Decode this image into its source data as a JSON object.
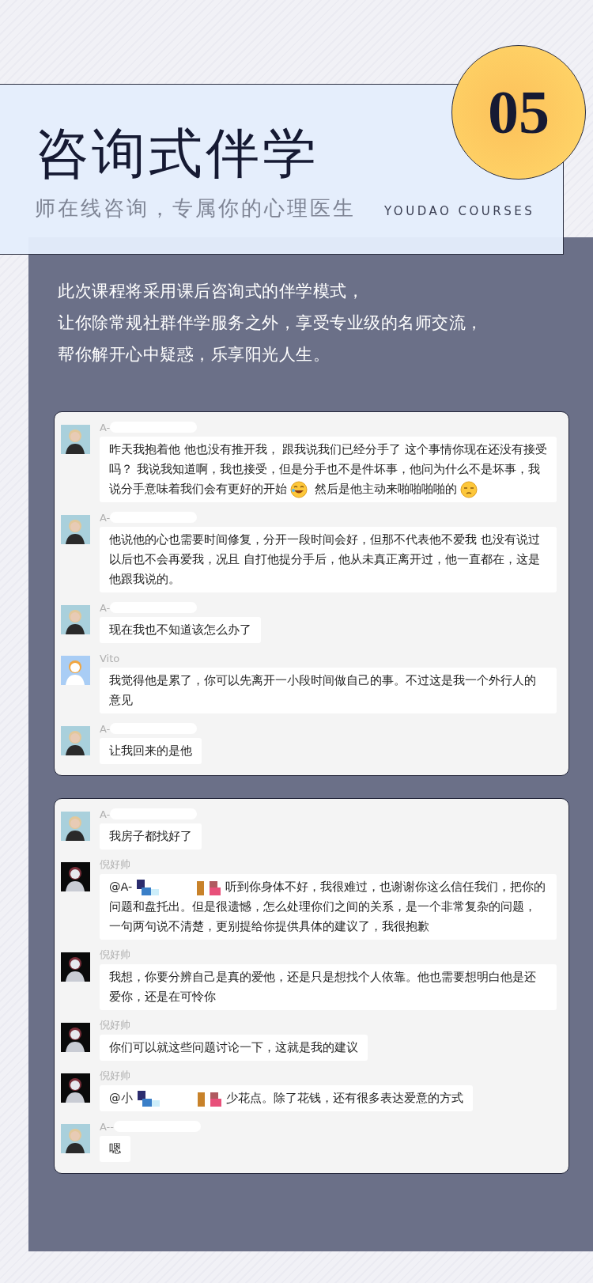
{
  "header": {
    "number": "05",
    "title": "咨询式伴学",
    "subtitle": "师在线咨询，专属你的心理医生",
    "brand": "YOUDAO COURSES"
  },
  "intro": [
    "此次课程将采用课后咨询式的伴学模式，",
    "让你除常规社群伴学服务之外，享受专业级的名师交流，",
    "帮你解开心中疑惑，乐享阳光人生。"
  ],
  "chats": [
    {
      "messages": [
        {
          "sender": "A-",
          "redacted": true,
          "kind": "light",
          "segments": [
            {
              "kind": "text",
              "text": "昨天我抱着他 他也没有推开我， 跟我说我们已经分手了 这个事情你现在还没有接受吗？ 我说我知道啊，我也接受，但是分手也不是件坏事，他问为什么不是坏事，我说分手意味着我们会有更好的开始"
            },
            {
              "kind": "emoji"
            },
            {
              "kind": "text",
              "text": " 然后是他主动来啪啪啪啪的"
            },
            {
              "kind": "emoji"
            }
          ]
        },
        {
          "sender": "A-",
          "redacted": true,
          "kind": "light",
          "segments": [
            {
              "kind": "text",
              "text": "他说他的心也需要时间修复，分开一段时间会好，但那不代表他不爱我 也没有说过以后也不会再爱我，况且 自打他提分手后，他从未真正离开过，他一直都在，这是他跟我说的。"
            }
          ]
        },
        {
          "sender": "A-",
          "redacted": true,
          "kind": "light",
          "segments": [
            {
              "kind": "text",
              "text": "现在我也不知道该怎么办了"
            }
          ]
        },
        {
          "sender": "Vito",
          "redacted": false,
          "kind": "cartoon",
          "segments": [
            {
              "kind": "text",
              "text": "我觉得他是累了，你可以先离开一小段时间做自己的事。不过这是我一个外行人的意见"
            }
          ]
        },
        {
          "sender": "A-",
          "redacted": true,
          "kind": "light",
          "segments": [
            {
              "kind": "text",
              "text": "让我回来的是他"
            }
          ]
        }
      ]
    },
    {
      "messages": [
        {
          "sender": "A-",
          "redacted": true,
          "kind": "light",
          "segments": [
            {
              "kind": "text",
              "text": "我房子都找好了"
            }
          ]
        },
        {
          "sender": "倪好帅",
          "redacted": false,
          "kind": "dark",
          "segments": [
            {
              "kind": "text",
              "text": "@A-"
            },
            {
              "kind": "mosaic"
            },
            {
              "kind": "text",
              "text": "听到你身体不好，我很难过，也谢谢你这么信任我们，把你的问题和盘托出。但是很遗憾，怎么处理你们之间的关系，是一个非常复杂的问题，一句两句说不清楚，更别提给你提供具体的建议了，我很抱歉"
            }
          ]
        },
        {
          "sender": "倪好帅",
          "redacted": false,
          "kind": "dark",
          "segments": [
            {
              "kind": "text",
              "text": "我想，你要分辨自己是真的爱他，还是只是想找个人依靠。他也需要想明白他是还爱你，还是在可怜你"
            }
          ]
        },
        {
          "sender": "倪好帅",
          "redacted": false,
          "kind": "dark",
          "segments": [
            {
              "kind": "text",
              "text": "你们可以就这些问题讨论一下，这就是我的建议"
            }
          ]
        },
        {
          "sender": "倪好帅",
          "redacted": false,
          "kind": "dark",
          "segments": [
            {
              "kind": "text",
              "text": "@小"
            },
            {
              "kind": "mosaic"
            },
            {
              "kind": "text",
              "text": "少花点。除了花钱，还有很多表达爱意的方式"
            }
          ]
        },
        {
          "sender": "A--",
          "redacted": true,
          "kind": "light",
          "segments": [
            {
              "kind": "text",
              "text": "嗯"
            }
          ]
        }
      ]
    }
  ]
}
